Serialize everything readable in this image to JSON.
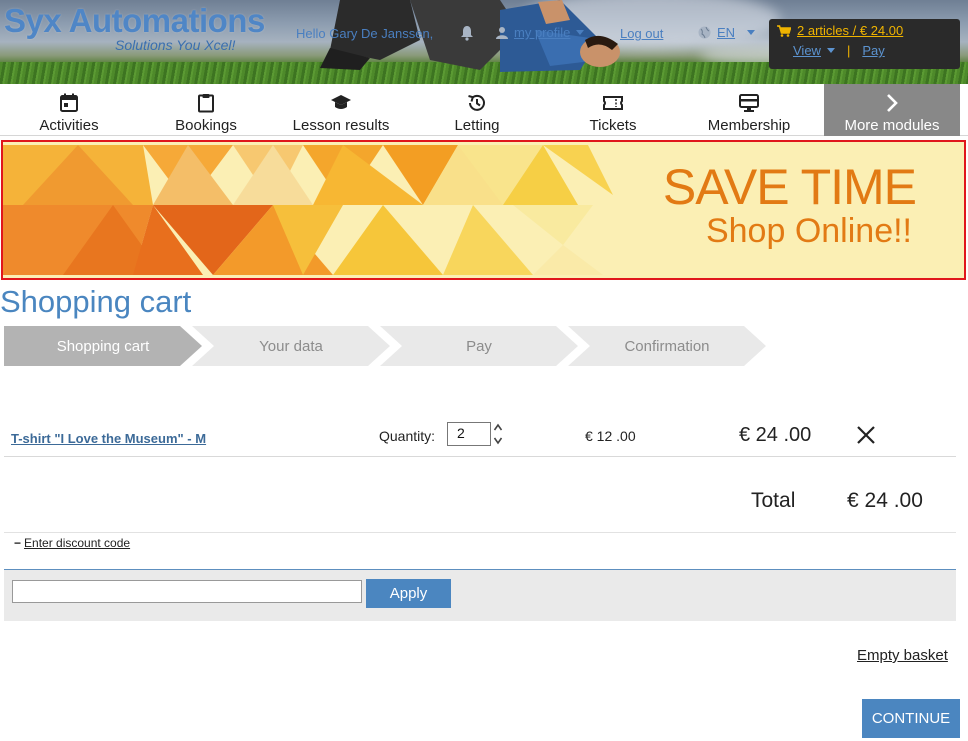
{
  "header": {
    "brand": "Syx Automations",
    "tagline": "Solutions You Xcel!",
    "greeting": "Hello Gary De Janssen,",
    "profile_label": "my profile",
    "logout_label": "Log out",
    "language": "EN"
  },
  "cart_widget": {
    "summary": "2 articles / € 24.00",
    "view_label": "View",
    "pay_label": "Pay",
    "accent_color": "#f0b400"
  },
  "nav": {
    "items": [
      {
        "label": "Activities",
        "icon": "calendar-icon"
      },
      {
        "label": "Bookings",
        "icon": "clipboard-icon"
      },
      {
        "label": "Lesson results",
        "icon": "graduation-cap-icon"
      },
      {
        "label": "Letting",
        "icon": "history-icon"
      },
      {
        "label": "Tickets",
        "icon": "ticket-icon"
      },
      {
        "label": "Membership",
        "icon": "membership-card-icon"
      }
    ],
    "more_label": "More modules"
  },
  "banner": {
    "title": "SAVE TIME",
    "subtitle": "Shop Online!!",
    "text_color": "#e27a14",
    "border_color": "#e0161c"
  },
  "page_title": "Shopping cart",
  "steps": [
    {
      "label": "Shopping cart",
      "active": true
    },
    {
      "label": "Your data",
      "active": false
    },
    {
      "label": "Pay",
      "active": false
    },
    {
      "label": "Confirmation",
      "active": false
    }
  ],
  "cart": {
    "items": [
      {
        "name": "T-shirt \"I Love the Museum\" - M",
        "quantity_label": "Quantity:",
        "quantity": "2",
        "unit_price": "€ 12 .00",
        "line_total": "€ 24 .00"
      }
    ],
    "total_label": "Total",
    "total_value": "€ 24 .00"
  },
  "discount": {
    "toggle_label": "Enter discount code",
    "input_value": "",
    "apply_label": "Apply"
  },
  "actions": {
    "empty_basket_label": "Empty basket",
    "continue_label": "CONTINUE"
  },
  "colors": {
    "primary": "#4b86c0",
    "title": "#4a86c0"
  }
}
